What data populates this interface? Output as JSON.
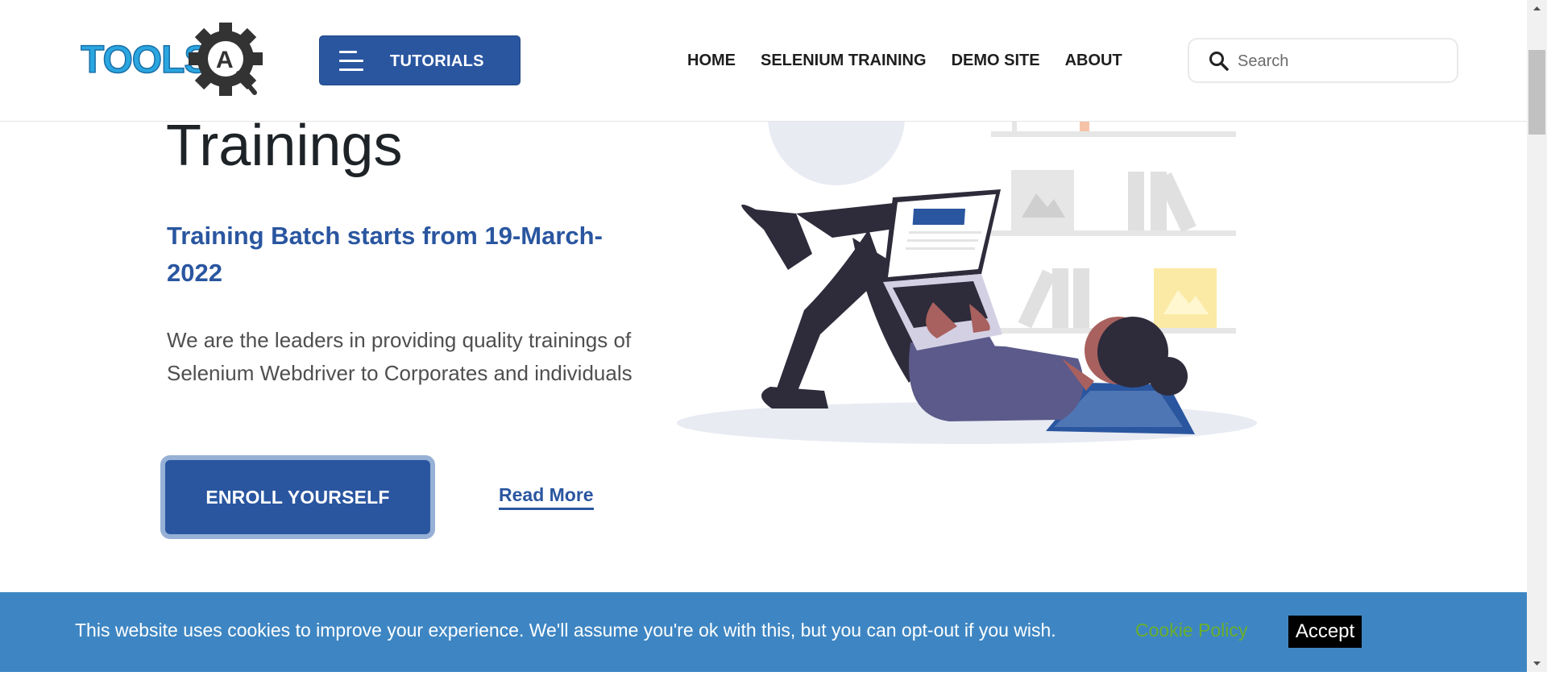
{
  "header": {
    "logo_text": "TOOLSQA",
    "tutorials_label": "TUTORIALS",
    "nav": [
      {
        "label": "HOME"
      },
      {
        "label": "SELENIUM TRAINING"
      },
      {
        "label": "DEMO SITE"
      },
      {
        "label": "ABOUT"
      }
    ],
    "search": {
      "placeholder": "Search",
      "value": ""
    }
  },
  "hero": {
    "title": "Trainings",
    "subtitle": "Training Batch starts from 19-March-2022",
    "description": "We are the leaders in providing quality trainings of Selenium Webdriver to Corporates and individuals",
    "enroll_label": "ENROLL YOURSELF",
    "read_more_label": "Read More"
  },
  "cookie_banner": {
    "text": "This website uses cookies to improve your experience. We'll assume you're ok with this, but you can opt-out if you wish.",
    "policy_label": "Cookie Policy",
    "accept_label": "Accept"
  },
  "colors": {
    "brand_blue": "#2a56a0",
    "cookie_bg": "#3e86c3",
    "cookie_link": "#6aae2b"
  },
  "icons": [
    "toolsqa-logo",
    "hamburger-icon",
    "search-icon",
    "illustration-reading-person"
  ]
}
